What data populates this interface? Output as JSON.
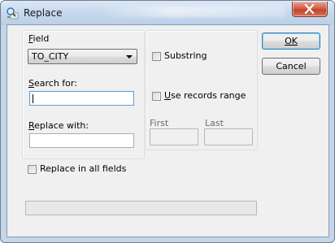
{
  "window": {
    "title": "Replace",
    "close_label": "Close"
  },
  "field": {
    "label": "Field",
    "selected": "TO_CITY"
  },
  "search": {
    "label": "Search for:",
    "value": ""
  },
  "replace": {
    "label": "Replace with:",
    "value": ""
  },
  "options": {
    "substring_label": "Substring",
    "substring_checked": false,
    "records_range_label": "Use records range",
    "records_range_checked": false,
    "first_label": "First",
    "last_label": "Last",
    "first_value": "",
    "last_value": "",
    "replace_all_label": "Replace in all fields",
    "replace_all_checked": false
  },
  "buttons": {
    "ok_label": "OK",
    "cancel_label": "Cancel"
  },
  "status": {
    "text": ""
  }
}
